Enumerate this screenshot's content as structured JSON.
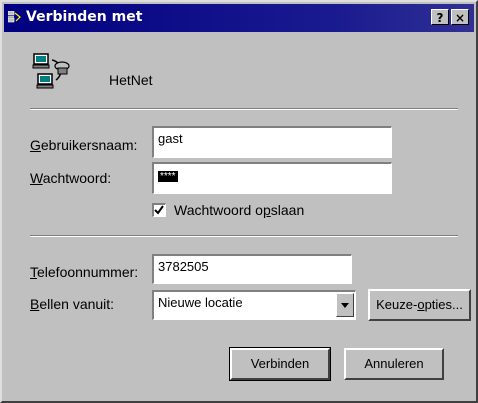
{
  "window": {
    "title": "Verbinden met",
    "help_label": "?",
    "close_label": "×"
  },
  "connection": {
    "name": "HetNet"
  },
  "username": {
    "label_key": "G",
    "label_rest": "ebruikersnaam:",
    "value": "gast"
  },
  "password": {
    "label_key": "W",
    "label_rest": "achtwoord:",
    "value": "****"
  },
  "save_password": {
    "checked": true,
    "label_pre": "Wachtwoord o",
    "label_key": "p",
    "label_post": "slaan"
  },
  "phone": {
    "label_key": "T",
    "label_rest": "elefoonnummer:",
    "value": "3782505"
  },
  "dial_from": {
    "label_key": "B",
    "label_rest": "ellen vanuit:",
    "selected": "Nieuwe locatie"
  },
  "buttons": {
    "options_pre": "Keuze-",
    "options_key": "o",
    "options_post": "pties...",
    "connect": "Verbinden",
    "cancel": "Annuleren"
  },
  "colors": {
    "titlebar": "#000080",
    "face": "#c0c0c0"
  }
}
